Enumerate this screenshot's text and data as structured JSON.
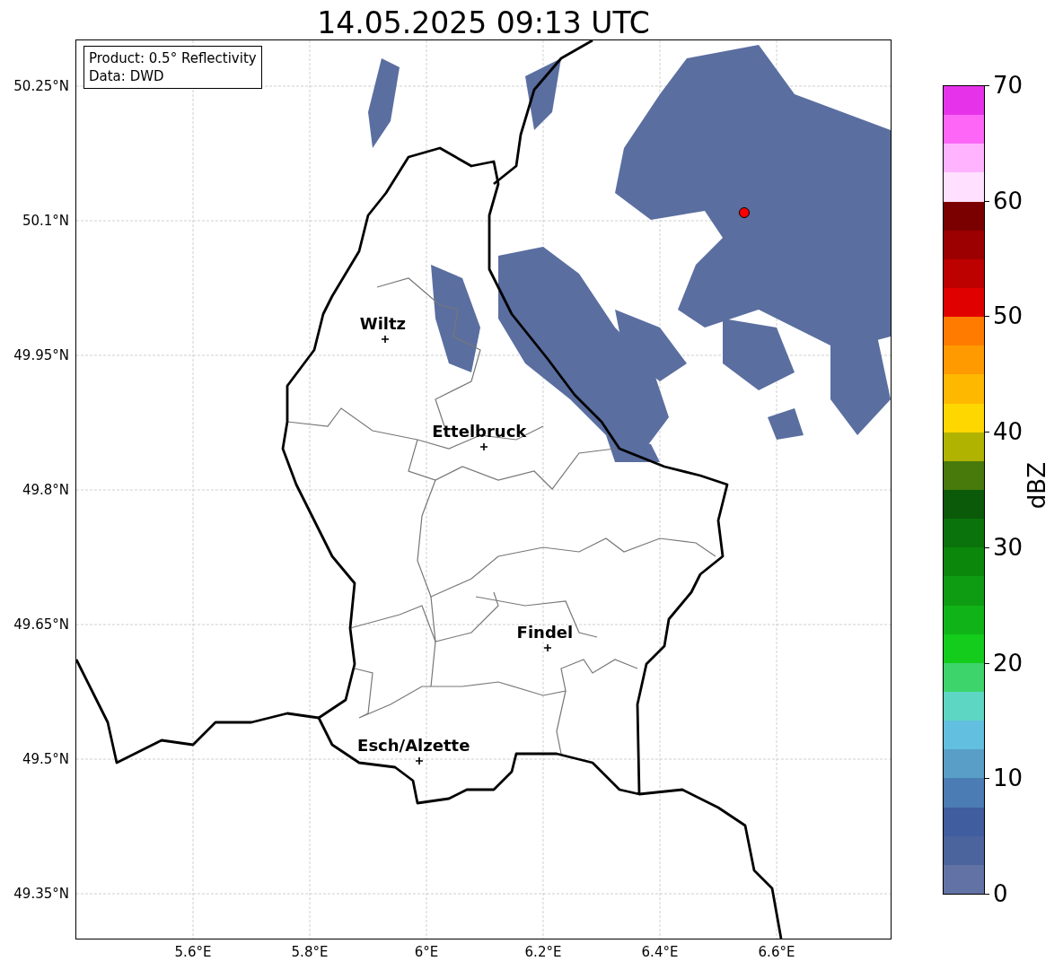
{
  "title": "14.05.2025 09:13 UTC",
  "info_box": [
    "Product: 0.5° Reflectivity",
    "Data: DWD"
  ],
  "cities": [
    {
      "name": "Wiltz"
    },
    {
      "name": "Ettelbruck"
    },
    {
      "name": "Findel"
    },
    {
      "name": "Esch/Alzette"
    }
  ],
  "lat_ticks": [
    "50.25°N",
    "50.1°N",
    "49.95°N",
    "49.8°N",
    "49.65°N",
    "49.5°N",
    "49.35°N"
  ],
  "lon_ticks": [
    "5.6°E",
    "5.8°E",
    "6°E",
    "6.2°E",
    "6.4°E",
    "6.6°E"
  ],
  "colorbar": {
    "label": "dBZ",
    "ticks": [
      "70",
      "60",
      "50",
      "40",
      "30",
      "20",
      "10",
      "0"
    ],
    "bins": [
      {
        "color": "#6272a5"
      },
      {
        "color": "#4c649e"
      },
      {
        "color": "#405da0"
      },
      {
        "color": "#4b7cb3"
      },
      {
        "color": "#589ec7"
      },
      {
        "color": "#62bfdf"
      },
      {
        "color": "#5ed6c4"
      },
      {
        "color": "#3dd46c"
      },
      {
        "color": "#13cc1b"
      },
      {
        "color": "#11b418"
      },
      {
        "color": "#0e9d12"
      },
      {
        "color": "#0b870b"
      },
      {
        "color": "#0b730b"
      },
      {
        "color": "#0a5a0a"
      },
      {
        "color": "#477a0b"
      },
      {
        "color": "#b0b300"
      },
      {
        "color": "#ffd700"
      },
      {
        "color": "#ffb800"
      },
      {
        "color": "#ff9a00"
      },
      {
        "color": "#ff7b00"
      },
      {
        "color": "#e00000"
      },
      {
        "color": "#bd0000"
      },
      {
        "color": "#9c0000"
      },
      {
        "color": "#7a0000"
      },
      {
        "color": "#ffe0fe"
      },
      {
        "color": "#ffb3fe"
      },
      {
        "color": "#fd66f7"
      },
      {
        "color": "#e633e9"
      }
    ]
  }
}
